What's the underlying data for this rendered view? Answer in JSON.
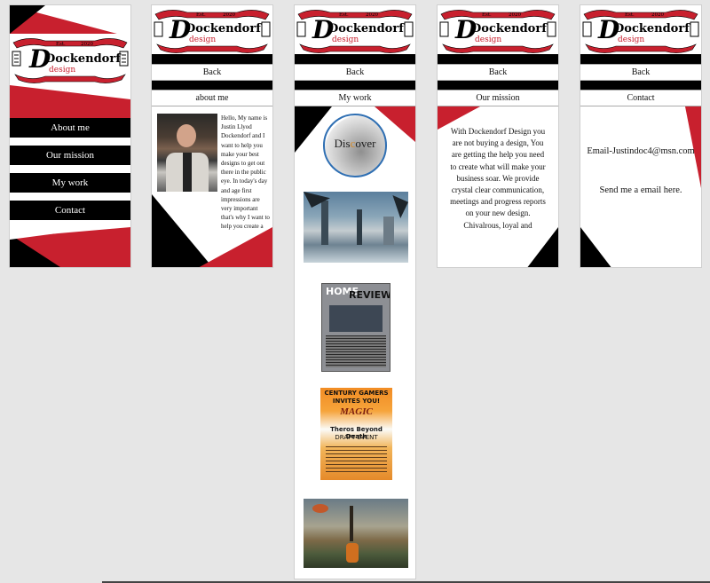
{
  "brand": {
    "name": "Dockendorf",
    "sub": "design",
    "est": "Est.",
    "year": "2020"
  },
  "colors": {
    "red": "#c8202e",
    "black": "#000000",
    "white": "#ffffff",
    "bg": "#e6e6e6"
  },
  "nav": {
    "back_label": "Back",
    "menu_items": [
      "About me",
      "Our mission",
      "My work",
      "Contact"
    ]
  },
  "about": {
    "title": "about me",
    "text": "Hello, My name is Justin Llyod Dockendorf and I want to help you make your best designs to get out there in the public eye. In today's day and age first impressions are very important that's why I want to help you create a"
  },
  "work": {
    "title": "My work",
    "discover": "Dis",
    "discover2": "over",
    "discover_c": "c",
    "home_review": {
      "home": "HOME",
      "review": "REVIEW"
    },
    "poster": {
      "line1": "CENTURY GAMERS",
      "line2": "INVITES YOU!",
      "line3": "MAGIC",
      "line4": "Theros Beyond Death",
      "line5": "DRAFT EVENT"
    }
  },
  "mission": {
    "title": "Our mission",
    "text": "With Dockendorf Design you are not buying a design, You are getting the help you need to create what will make your business soar. We provide crystal clear communication, meetings and progress reports on your new design. Chivalrous, loyal and"
  },
  "contact": {
    "title": "Contact",
    "email": "Email-Justindoc4@msn.com",
    "cta": "Send me a email here."
  }
}
